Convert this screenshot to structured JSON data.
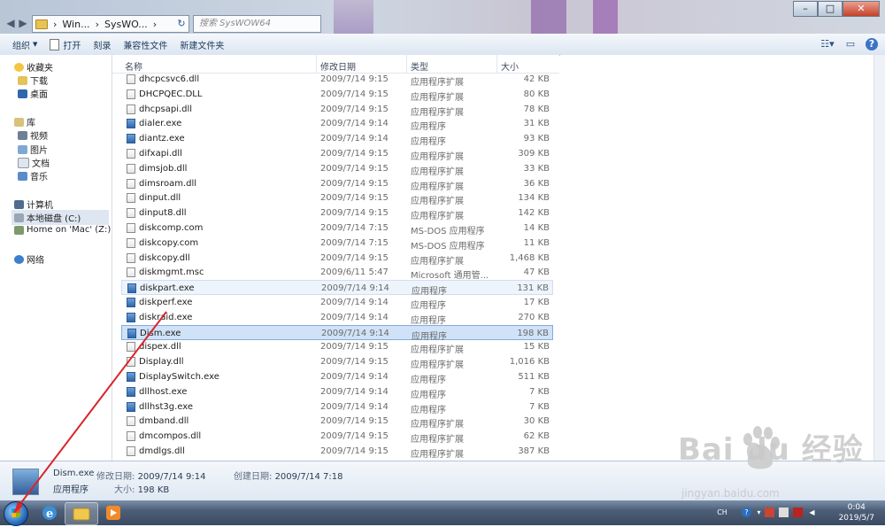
{
  "window": {
    "breadcrumb": [
      "Win...",
      "SysWO..."
    ],
    "search_placeholder": "搜索 SysWOW64",
    "controls": {
      "minimize": "–",
      "maximize": "□",
      "close": "✕"
    }
  },
  "toolbar": {
    "organize": "组织",
    "open": "打开",
    "burn": "刻录",
    "compat": "兼容性文件",
    "new_folder": "新建文件夹"
  },
  "nav": {
    "favorites": "收藏夹",
    "downloads": "下载",
    "desktop": "桌面",
    "libraries": "库",
    "videos": "视频",
    "pictures": "图片",
    "documents": "文档",
    "music": "音乐",
    "computer": "计算机",
    "local_disk": "本地磁盘 (C:)",
    "home_mac": "Home on 'Mac' (Z:)",
    "network": "网络"
  },
  "columns": {
    "name": "名称",
    "date": "修改日期",
    "type": "类型",
    "size": "大小"
  },
  "files": [
    {
      "name": "dhcpcsvc6.dll",
      "date": "2009/7/14 9:15",
      "type": "应用程序扩展",
      "size": "42 KB",
      "exe": false
    },
    {
      "name": "DHCPQEC.DLL",
      "date": "2009/7/14 9:15",
      "type": "应用程序扩展",
      "size": "80 KB",
      "exe": false
    },
    {
      "name": "dhcpsapi.dll",
      "date": "2009/7/14 9:15",
      "type": "应用程序扩展",
      "size": "78 KB",
      "exe": false
    },
    {
      "name": "dialer.exe",
      "date": "2009/7/14 9:14",
      "type": "应用程序",
      "size": "31 KB",
      "exe": true
    },
    {
      "name": "diantz.exe",
      "date": "2009/7/14 9:14",
      "type": "应用程序",
      "size": "93 KB",
      "exe": true
    },
    {
      "name": "difxapi.dll",
      "date": "2009/7/14 9:15",
      "type": "应用程序扩展",
      "size": "309 KB",
      "exe": false
    },
    {
      "name": "dimsjob.dll",
      "date": "2009/7/14 9:15",
      "type": "应用程序扩展",
      "size": "33 KB",
      "exe": false
    },
    {
      "name": "dimsroam.dll",
      "date": "2009/7/14 9:15",
      "type": "应用程序扩展",
      "size": "36 KB",
      "exe": false
    },
    {
      "name": "dinput.dll",
      "date": "2009/7/14 9:15",
      "type": "应用程序扩展",
      "size": "134 KB",
      "exe": false
    },
    {
      "name": "dinput8.dll",
      "date": "2009/7/14 9:15",
      "type": "应用程序扩展",
      "size": "142 KB",
      "exe": false
    },
    {
      "name": "diskcomp.com",
      "date": "2009/7/14 7:15",
      "type": "MS-DOS 应用程序",
      "size": "14 KB",
      "exe": false
    },
    {
      "name": "diskcopy.com",
      "date": "2009/7/14 7:15",
      "type": "MS-DOS 应用程序",
      "size": "11 KB",
      "exe": false
    },
    {
      "name": "diskcopy.dll",
      "date": "2009/7/14 9:15",
      "type": "应用程序扩展",
      "size": "1,468 KB",
      "exe": false
    },
    {
      "name": "diskmgmt.msc",
      "date": "2009/6/11 5:47",
      "type": "Microsoft 通用管...",
      "size": "47 KB",
      "exe": false
    },
    {
      "name": "diskpart.exe",
      "date": "2009/7/14 9:14",
      "type": "应用程序",
      "size": "131 KB",
      "exe": true
    },
    {
      "name": "diskperf.exe",
      "date": "2009/7/14 9:14",
      "type": "应用程序",
      "size": "17 KB",
      "exe": true
    },
    {
      "name": "diskraid.exe",
      "date": "2009/7/14 9:14",
      "type": "应用程序",
      "size": "270 KB",
      "exe": true
    },
    {
      "name": "Dism.exe",
      "date": "2009/7/14 9:14",
      "type": "应用程序",
      "size": "198 KB",
      "exe": true
    },
    {
      "name": "dispex.dll",
      "date": "2009/7/14 9:15",
      "type": "应用程序扩展",
      "size": "15 KB",
      "exe": false
    },
    {
      "name": "Display.dll",
      "date": "2009/7/14 9:15",
      "type": "应用程序扩展",
      "size": "1,016 KB",
      "exe": false
    },
    {
      "name": "DisplaySwitch.exe",
      "date": "2009/7/14 9:14",
      "type": "应用程序",
      "size": "511 KB",
      "exe": true
    },
    {
      "name": "dllhost.exe",
      "date": "2009/7/14 9:14",
      "type": "应用程序",
      "size": "7 KB",
      "exe": true
    },
    {
      "name": "dllhst3g.exe",
      "date": "2009/7/14 9:14",
      "type": "应用程序",
      "size": "7 KB",
      "exe": true
    },
    {
      "name": "dmband.dll",
      "date": "2009/7/14 9:15",
      "type": "应用程序扩展",
      "size": "30 KB",
      "exe": false
    },
    {
      "name": "dmcompos.dll",
      "date": "2009/7/14 9:15",
      "type": "应用程序扩展",
      "size": "62 KB",
      "exe": false
    },
    {
      "name": "dmdlgs.dll",
      "date": "2009/7/14 9:15",
      "type": "应用程序扩展",
      "size": "387 KB",
      "exe": false
    }
  ],
  "details": {
    "name": "Dism.exe",
    "modified_label": "修改日期:",
    "modified": "2009/7/14 9:14",
    "created_label": "创建日期:",
    "created": "2009/7/14 7:18",
    "type": "应用程序",
    "size_label": "大小:",
    "size": "198 KB"
  },
  "taskbar": {
    "lang": "CH",
    "time": "0:04",
    "date": "2019/5/7"
  },
  "watermark": {
    "brand": "Bai du 经验",
    "url": "jingyan.baidu.com"
  }
}
